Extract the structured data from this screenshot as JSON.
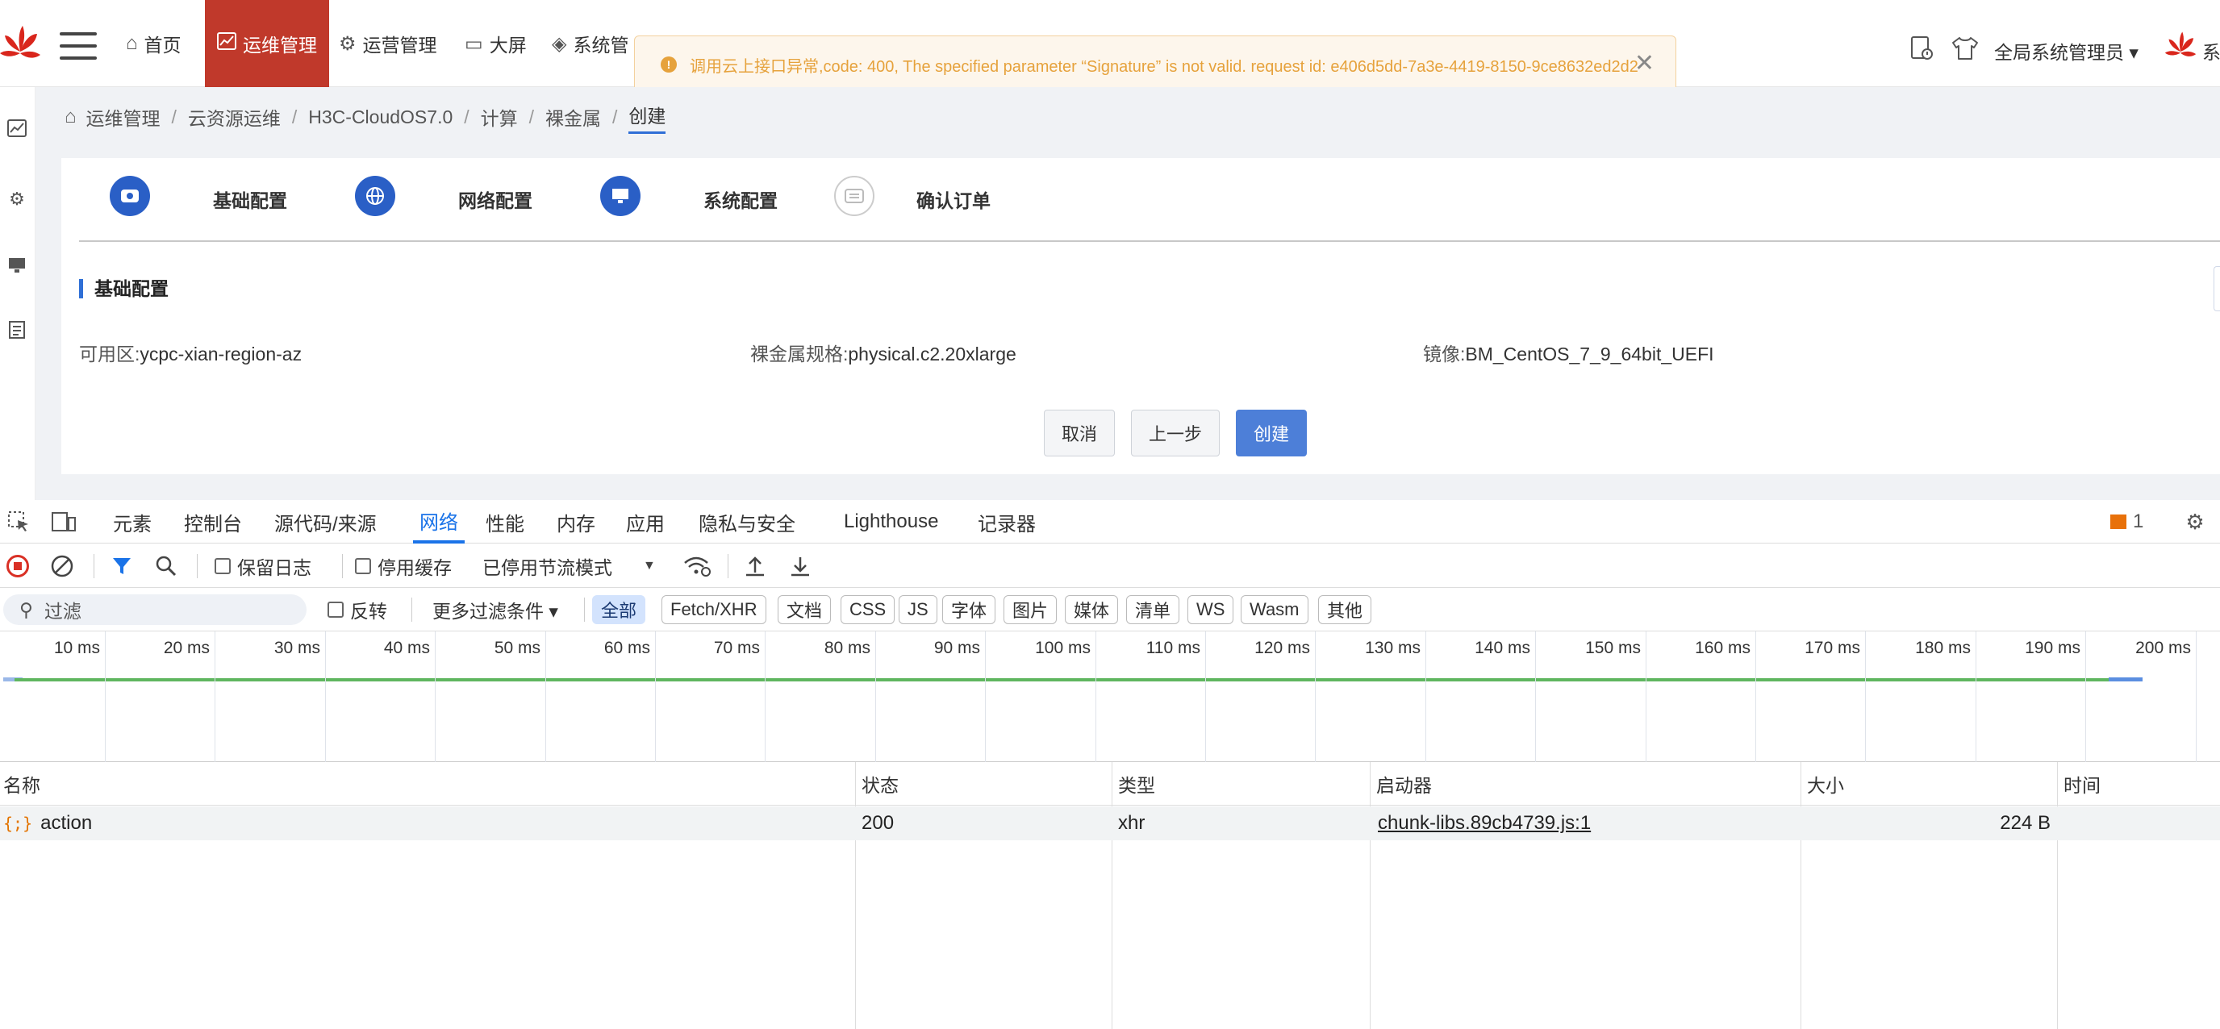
{
  "nav": {
    "items": [
      {
        "label": "首页",
        "icon": "home-icon"
      },
      {
        "label": "运维管理",
        "icon": "chart-icon"
      },
      {
        "label": "运营管理",
        "icon": "operations-icon"
      },
      {
        "label": "大屏",
        "icon": "monitor-icon"
      },
      {
        "label": "系统管",
        "icon": "layers-icon"
      }
    ],
    "user": "全局系统管理员 ▾",
    "sys_label": "系"
  },
  "toast": {
    "message": "调用云上接口异常,code: 400, The specified parameter “Signature” is not valid. request id: e406d5dd-7a3e-4419-8150-9ce8632ed2d2",
    "close": "✕"
  },
  "breadcrumb": [
    "运维管理",
    "云资源运维",
    "H3C-CloudOS7.0",
    "计算",
    "裸金属",
    "创建"
  ],
  "steps": [
    {
      "label": "基础配置",
      "icon": "cloud-icon"
    },
    {
      "label": "网络配置",
      "icon": "globe-icon"
    },
    {
      "label": "系统配置",
      "icon": "monitor-icon"
    },
    {
      "label": "确认订单",
      "icon": "order-icon"
    }
  ],
  "section": {
    "title": "基础配置"
  },
  "fields": [
    {
      "key": "可用区:",
      "value": "ycpc-xian-region-az"
    },
    {
      "key": "裸金属规格:",
      "value": "physical.c2.20xlarge"
    },
    {
      "key": "镜像:",
      "value": "BM_CentOS_7_9_64bit_UEFI"
    }
  ],
  "buttons": {
    "cancel": "取消",
    "prev": "上一步",
    "create": "创建"
  },
  "devtools": {
    "tabs": [
      "元素",
      "控制台",
      "源代码/来源",
      "网络",
      "性能",
      "内存",
      "应用",
      "隐私与安全",
      "Lighthouse",
      "记录器"
    ],
    "active_tab": "网络",
    "issues_count": "1",
    "toolbar": {
      "preserve_log": "保留日志",
      "disable_cache": "停用缓存",
      "throttle": "已停用节流模式"
    },
    "filter": {
      "placeholder": "过滤",
      "invert": "反转",
      "more_filters": "更多过滤条件 ▾",
      "chips": [
        "全部",
        "Fetch/XHR",
        "文档",
        "CSS",
        "JS",
        "字体",
        "图片",
        "媒体",
        "清单",
        "WS",
        "Wasm",
        "其他"
      ],
      "active_chip": "全部"
    },
    "timeline_ticks": [
      "10 ms",
      "20 ms",
      "30 ms",
      "40 ms",
      "50 ms",
      "60 ms",
      "70 ms",
      "80 ms",
      "90 ms",
      "100 ms",
      "110 ms",
      "120 ms",
      "130 ms",
      "140 ms",
      "150 ms",
      "160 ms",
      "170 ms",
      "180 ms",
      "190 ms",
      "200 ms"
    ],
    "columns": [
      "名称",
      "状态",
      "类型",
      "启动器",
      "大小",
      "时间"
    ],
    "rows": [
      {
        "name": "action",
        "status": "200",
        "type": "xhr",
        "initiator": "chunk-libs.89cb4739.js:1",
        "size": "224 B",
        "time": ""
      }
    ]
  },
  "colors": {
    "nav_active": "#c0392b",
    "primary": "#4d7fd8",
    "step": "#2a5fc6",
    "warning": "#e6a23c",
    "devtools_accent": "#1a73e8"
  }
}
